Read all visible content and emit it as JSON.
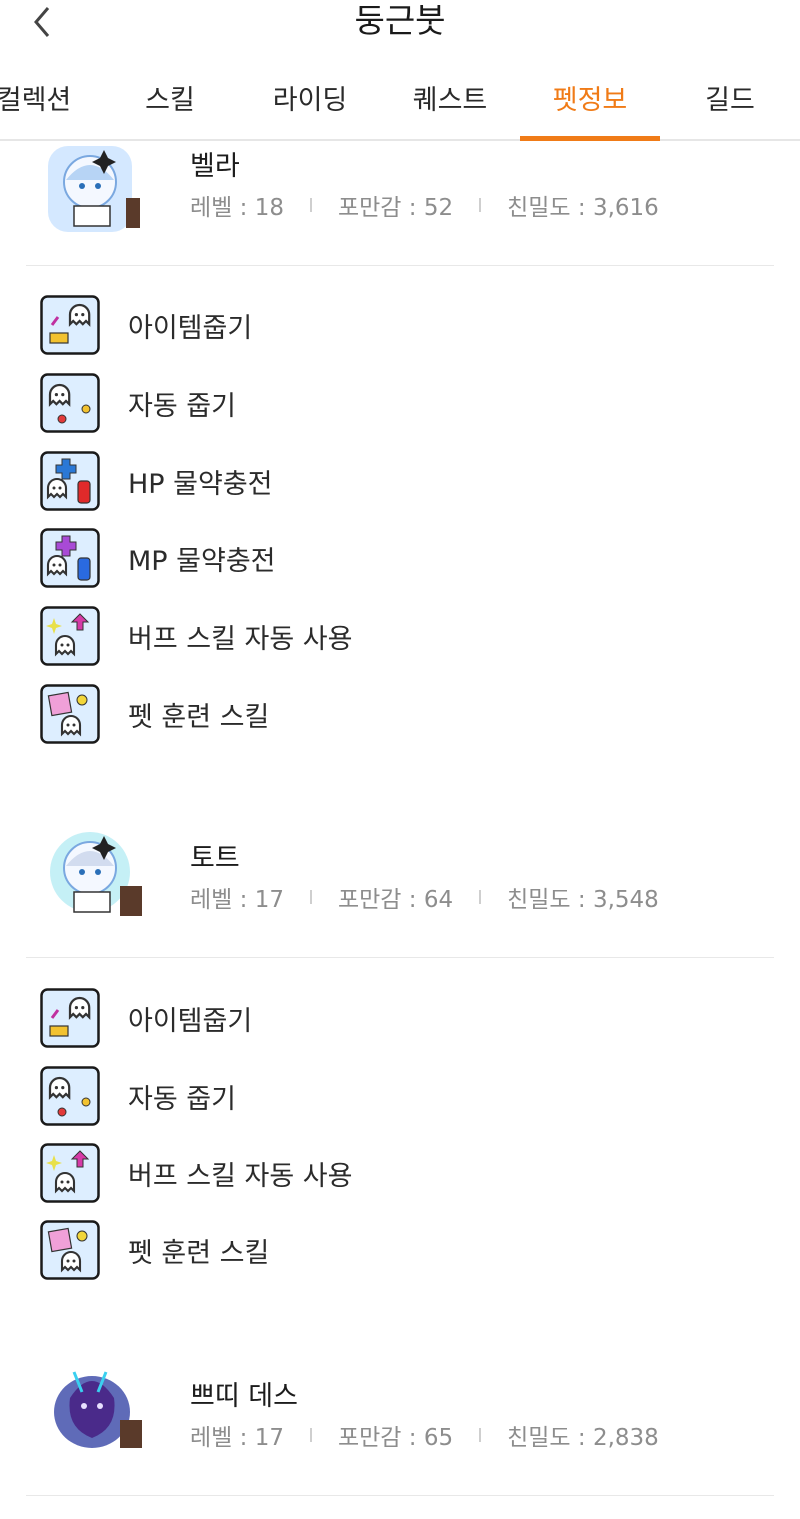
{
  "header": {
    "title": "둥근붓",
    "back_icon": "chevron-left-icon"
  },
  "tabs": [
    {
      "label": "컬렉션",
      "active": false
    },
    {
      "label": "스킬",
      "active": false
    },
    {
      "label": "라이딩",
      "active": false
    },
    {
      "label": "퀘스트",
      "active": false
    },
    {
      "label": "펫정보",
      "active": true
    },
    {
      "label": "길드",
      "active": false
    }
  ],
  "colors": {
    "accent": "#f07b17",
    "stat_text": "#8d8d8d",
    "divider": "#e8e8e8"
  },
  "pets": [
    {
      "name": "벨라",
      "level": "레벨 : 18",
      "fullness": "포만감 : 52",
      "intimacy": "친밀도 : 3,616",
      "skills": [
        "아이템줍기",
        "자동 줍기",
        "HP 물약충전",
        "MP 물약충전",
        "버프 스킬 자동 사용",
        "펫 훈련 스킬"
      ]
    },
    {
      "name": "토트",
      "level": "레벨 : 17",
      "fullness": "포만감 : 64",
      "intimacy": "친밀도 : 3,548",
      "skills": [
        "아이템줍기",
        "자동 줍기",
        "버프 스킬 자동 사용",
        "펫 훈련 스킬"
      ]
    },
    {
      "name": "쁘띠 데스",
      "level": "레벨 : 17",
      "fullness": "포만감 : 65",
      "intimacy": "친밀도 : 2,838",
      "skills": []
    }
  ]
}
